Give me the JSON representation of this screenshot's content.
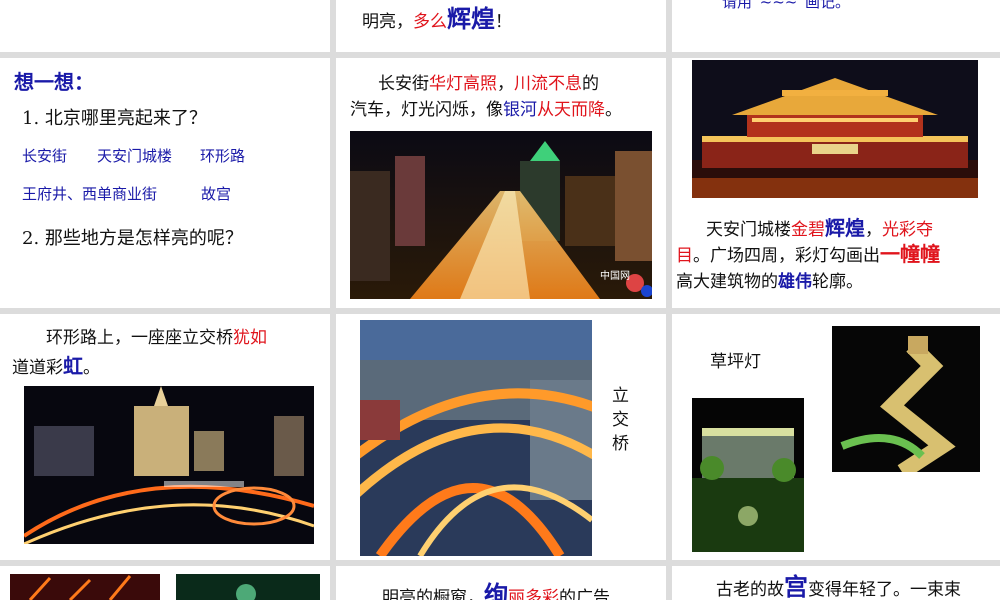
{
  "s1": {
    "line": [
      "明亮，",
      "多么",
      "辉煌",
      "！"
    ]
  },
  "s2": {
    "line": [
      "请用“",
      "~~~",
      "”画记。"
    ]
  },
  "s4": {
    "title": "想一想：",
    "q1": "1. 北京哪里亮起来了？",
    "a1": [
      "长安街",
      "天安门城楼",
      "环形路"
    ],
    "a2": [
      "王府井、西单商业街",
      "故宫"
    ],
    "q2": "2. 那些地方是怎样亮的呢？"
  },
  "s5": {
    "line1": [
      "长安街",
      "华灯高照",
      "，",
      "川流不息",
      "的"
    ],
    "line2": [
      "汽车，灯光闪烁，像",
      "银河",
      "从天而降",
      "。"
    ],
    "watermark": "中国网"
  },
  "s6": {
    "line1": [
      "天安门城楼",
      "金碧",
      "辉煌",
      "，",
      "光彩夺"
    ],
    "line2": [
      "目",
      "。广场四周，彩灯勾画出",
      "一幢幢"
    ],
    "line3": [
      "高大建筑物的",
      "雄伟",
      "轮廓。"
    ]
  },
  "s7": {
    "line1": [
      "环形路上，一座座立交桥",
      "犹如"
    ],
    "line2": [
      "道道彩",
      "虹",
      "。"
    ]
  },
  "s8": {
    "vlabel": [
      "立",
      "交",
      "桥"
    ]
  },
  "s9": {
    "label": "草坪灯"
  },
  "s11": {
    "line": [
      "明亮的橱窗，",
      "绚",
      "丽多彩",
      "的广告"
    ]
  },
  "s12": {
    "line": [
      "古老的故",
      "宫",
      "变得年轻了。一束束"
    ]
  }
}
